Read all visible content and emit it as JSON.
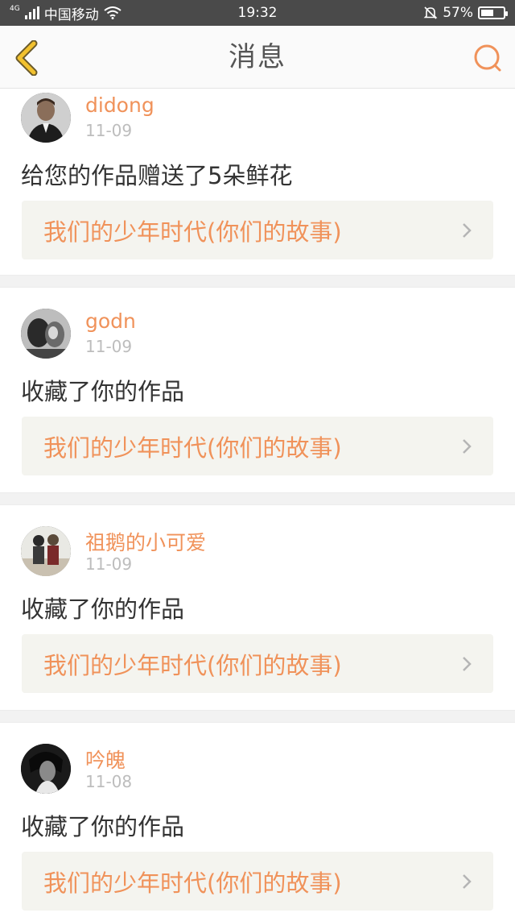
{
  "status": {
    "signal_badge": "4G",
    "carrier": "中国移动",
    "time": "19:32",
    "battery": "57%",
    "battery_level": 0.57
  },
  "header": {
    "title": "消息",
    "back_icon": "back-chevron-icon",
    "search_icon": "search-icon"
  },
  "colors": {
    "accent": "#f0925a",
    "back_icon": "#f2c12e"
  },
  "messages": [
    {
      "user": "didong",
      "date": "11-09",
      "action": "给您的作品赠送了5朵鲜花",
      "work": "我们的少年时代(你们的故事)"
    },
    {
      "user": "godn",
      "date": "11-09",
      "action": "收藏了你的作品",
      "work": "我们的少年时代(你们的故事)"
    },
    {
      "user": "祖鹅的小可爱",
      "date": "11-09",
      "action": "收藏了你的作品",
      "work": "我们的少年时代(你们的故事)"
    },
    {
      "user": "吟魄",
      "date": "11-08",
      "action": "收藏了你的作品",
      "work": "我们的少年时代(你们的故事)"
    }
  ]
}
